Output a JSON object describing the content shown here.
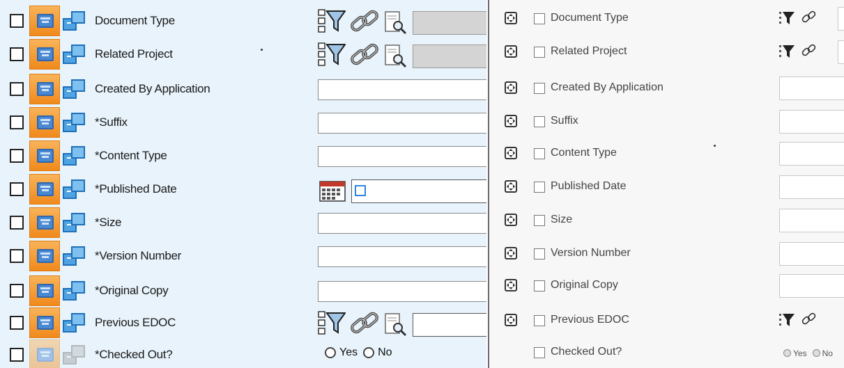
{
  "left_panel": {
    "rows": [
      {
        "label": "Document Type",
        "control": "lookup-gray"
      },
      {
        "label": "Related Project",
        "control": "lookup-gray"
      },
      {
        "label": "Created By Application",
        "control": "text"
      },
      {
        "label": "*Suffix",
        "control": "text"
      },
      {
        "label": "*Content Type",
        "control": "text"
      },
      {
        "label": "*Published Date",
        "control": "date"
      },
      {
        "label": "*Size",
        "control": "text"
      },
      {
        "label": "*Version Number",
        "control": "text"
      },
      {
        "label": "*Original Copy",
        "control": "text"
      },
      {
        "label": "Previous EDOC",
        "control": "lookup-white"
      },
      {
        "label": "*Checked Out?",
        "control": "radio",
        "dimmed": true
      }
    ],
    "radio": {
      "yes": "Yes",
      "no": "No"
    }
  },
  "right_panel": {
    "rows": [
      {
        "label": "Document Type",
        "control": "lookup"
      },
      {
        "label": "Related Project",
        "control": "lookup"
      },
      {
        "label": "Created By Application",
        "control": "text"
      },
      {
        "label": "Suffix",
        "control": "text"
      },
      {
        "label": "Content Type",
        "control": "text"
      },
      {
        "label": "Published Date",
        "control": "text"
      },
      {
        "label": "Size",
        "control": "text"
      },
      {
        "label": "Version Number",
        "control": "text"
      },
      {
        "label": "Original Copy",
        "control": "text"
      },
      {
        "label": "Previous EDOC",
        "control": "lookup-noinput"
      },
      {
        "label": "Checked Out?",
        "control": "radio",
        "no_expand": true
      }
    ],
    "radio": {
      "yes": "Yes",
      "no": "No"
    }
  },
  "icons": {
    "left_field_icon": "field-properties-icon",
    "left_copy_icon": "copy-windows-icon",
    "filter": "filter-icon",
    "link": "link-icon",
    "lookup": "magnifier-page-icon",
    "calendar": "calendar-icon",
    "expand": "expand-arrows-icon"
  },
  "colors": {
    "left_bg": "#e8f3fb",
    "right_bg": "#f7f7f7",
    "orange_tile": "#f08a1c",
    "blue_icon": "#1e6fb8"
  }
}
